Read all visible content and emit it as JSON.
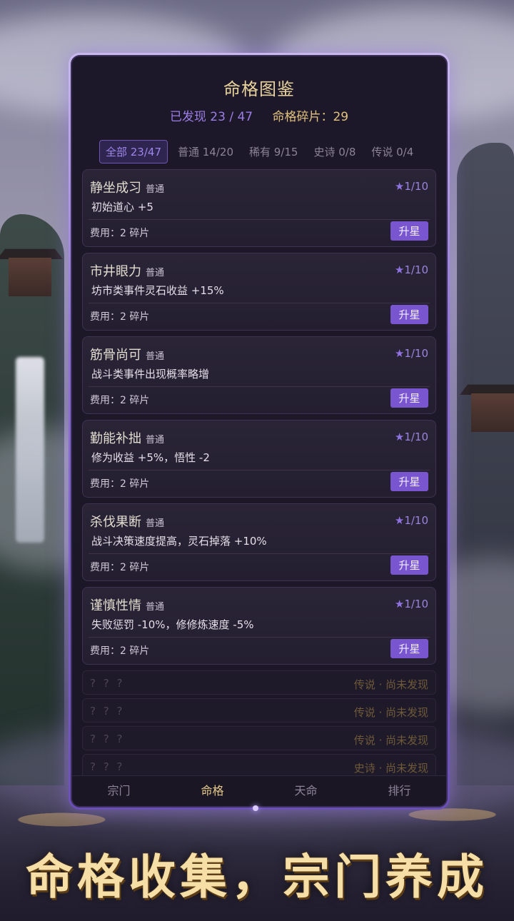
{
  "panel": {
    "title": "命格图鉴",
    "found": "已发现 23 / 47",
    "fragments": "命格碎片：29"
  },
  "tabs": [
    {
      "label": "全部 23/47",
      "active": true
    },
    {
      "label": "普通 14/20",
      "active": false
    },
    {
      "label": "稀有 9/15",
      "active": false
    },
    {
      "label": "史诗 0/8",
      "active": false
    },
    {
      "label": "传说 0/4",
      "active": false
    }
  ],
  "cards": [
    {
      "name": "静坐成习",
      "rarity": "普通",
      "level": "1/10",
      "desc": "初始道心 +5",
      "cost": "费用：2 碎片",
      "button": "升星"
    },
    {
      "name": "市井眼力",
      "rarity": "普通",
      "level": "1/10",
      "desc": "坊市类事件灵石收益 +15%",
      "cost": "费用：2 碎片",
      "button": "升星"
    },
    {
      "name": "筋骨尚可",
      "rarity": "普通",
      "level": "1/10",
      "desc": "战斗类事件出现概率略增",
      "cost": "费用：2 碎片",
      "button": "升星"
    },
    {
      "name": "勤能补拙",
      "rarity": "普通",
      "level": "1/10",
      "desc": "修为收益 +5%，悟性 -2",
      "cost": "费用：2 碎片",
      "button": "升星"
    },
    {
      "name": "杀伐果断",
      "rarity": "普通",
      "level": "1/10",
      "desc": "战斗决策速度提高，灵石掉落 +10%",
      "cost": "费用：2 碎片",
      "button": "升星"
    },
    {
      "name": "谨慎性情",
      "rarity": "普通",
      "level": "1/10",
      "desc": "失败惩罚 -10%，修修炼速度 -5%",
      "cost": "费用：2 碎片",
      "button": "升星"
    }
  ],
  "locked": [
    {
      "name": "? ? ?",
      "status": "传说 · 尚未发现"
    },
    {
      "name": "? ? ?",
      "status": "传说 · 尚未发现"
    },
    {
      "name": "? ? ?",
      "status": "传说 · 尚未发现"
    },
    {
      "name": "? ? ?",
      "status": "史诗 · 尚未发现"
    }
  ],
  "nav": [
    {
      "label": "宗门",
      "active": false
    },
    {
      "label": "命格",
      "active": true
    },
    {
      "label": "天命",
      "active": false
    },
    {
      "label": "排行",
      "active": false
    }
  ],
  "banner": "命格收集，宗门养成",
  "star_glyph": "★",
  "colors": {
    "accent": "#7a55d0",
    "gold": "#e8d39c",
    "panel_bg": "#1d1829"
  }
}
